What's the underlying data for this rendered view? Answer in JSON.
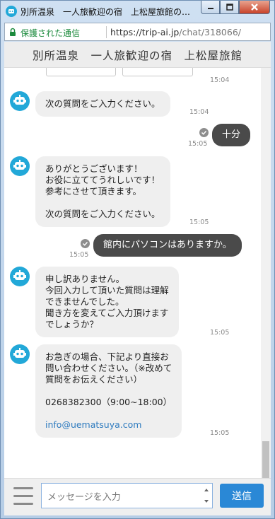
{
  "window": {
    "title": "別所温泉　一人旅歓迎の宿　上松屋旅館の…"
  },
  "addressbar": {
    "secure_label": "保護された通信",
    "url_host": "https://trip-ai.jp",
    "url_path": "/chat/318066/"
  },
  "chat": {
    "header_title": "別所温泉　一人旅歓迎の宿　上松屋旅館",
    "messages": [
      {
        "from": "bot",
        "lines": [
          "次の質問をご入力ください。"
        ],
        "time": "15:04"
      },
      {
        "from": "user",
        "text": "十分",
        "time": "15:05"
      },
      {
        "from": "bot",
        "lines": [
          "ありがとうございます！",
          "お役に立ててうれしいです！",
          "参考にさせて頂きます。",
          "",
          "次の質問をご入力ください。"
        ],
        "time": "15:05"
      },
      {
        "from": "user",
        "text": "館内にパソコンはありますか。",
        "time": "15:05"
      },
      {
        "from": "bot",
        "lines": [
          "申し訳ありません。",
          "今回入力して頂いた質問は理解",
          "できませんでした。",
          "聞き方を変えてご入力頂けます",
          "でしょうか？"
        ],
        "time": "15:05"
      },
      {
        "from": "bot",
        "lines": [
          "お急ぎの場合、下記より直接お",
          "問い合わせください。（※改めて",
          "質問をお伝えください）",
          "",
          "0268382300（9:00~18:00）",
          ""
        ],
        "link": "info@uematsuya.com",
        "time": "15:05"
      }
    ],
    "first_time": "15:04"
  },
  "composer": {
    "placeholder": "メッセージを入力",
    "send_label": "送信"
  },
  "colors": {
    "accent": "#2a88d6",
    "bot_avatar": "#22a8d8",
    "user_bubble": "#4a4a4a",
    "bot_bubble": "#efefef",
    "secure": "#1b8a3c"
  }
}
